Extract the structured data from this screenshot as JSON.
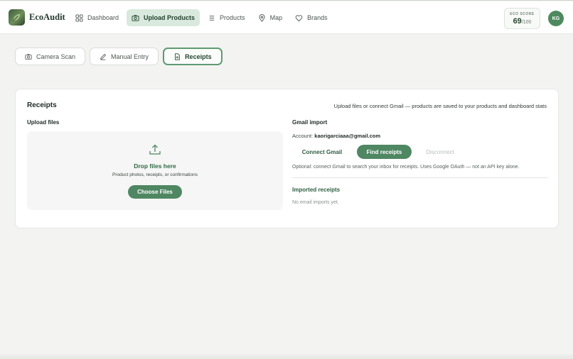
{
  "header": {
    "brand": "EcoAudit",
    "nav": [
      {
        "label": "Dashboard",
        "icon": "grid-icon",
        "active": false
      },
      {
        "label": "Upload Products",
        "icon": "camera-icon",
        "active": true
      },
      {
        "label": "Products",
        "icon": "list-icon",
        "active": false
      },
      {
        "label": "Map",
        "icon": "map-pin-icon",
        "active": false
      },
      {
        "label": "Brands",
        "icon": "heart-icon",
        "active": false
      }
    ],
    "eco_score": {
      "label": "ECO SCORE",
      "value": "69",
      "suffix": "/100"
    },
    "avatar_initials": "KG"
  },
  "modes": [
    {
      "label": "Camera Scan",
      "icon": "camera-icon",
      "active": false
    },
    {
      "label": "Manual Entry",
      "icon": "pencil-icon",
      "active": false
    },
    {
      "label": "Receipts",
      "icon": "document-icon",
      "active": true
    }
  ],
  "receipts": {
    "title": "Receipts",
    "description": "Upload files or connect Gmail — products are saved to your products and dashboard stats",
    "upload": {
      "label": "Upload files",
      "drop_title": "Drop files here",
      "drop_sub": "Product photos, receipts, or confirmations",
      "button": "Choose Files"
    },
    "gmail": {
      "label": "Gmail import",
      "account_label": "Account:",
      "account_email": "kaorigarciaaa@gmail.com",
      "connect": "Connect Gmail",
      "find": "Find receipts",
      "disconnect": "Disconnect",
      "optional_note": "Optional: connect Gmail to search your inbox for receipts. Uses Google OAuth — not an API key alone.",
      "imported_title": "Imported receipts",
      "imported_empty": "No email imports yet."
    }
  },
  "colors": {
    "accent": "#4e8762",
    "accent_light": "#d9e9dd",
    "background": "#f3f4f1"
  }
}
